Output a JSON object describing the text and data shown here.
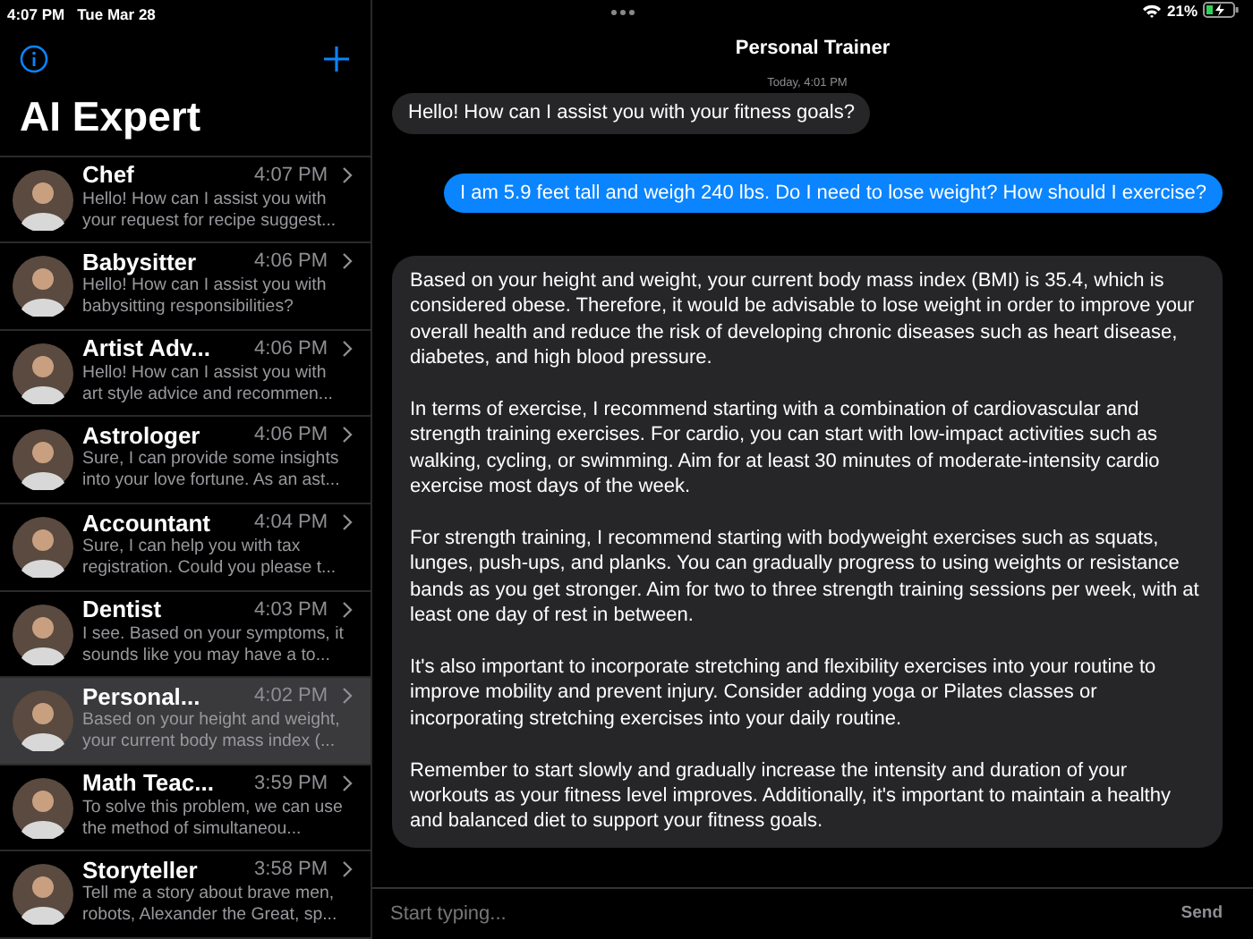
{
  "status_bar": {
    "time": "4:07 PM",
    "date": "Tue Mar 28",
    "battery": "21%"
  },
  "sidebar": {
    "title": "AI Expert",
    "items": [
      {
        "name": "Chef",
        "time": "4:07 PM",
        "preview": "Hello! How can I assist you with your request for recipe suggest...",
        "selected": false
      },
      {
        "name": "Babysitter",
        "time": "4:06 PM",
        "preview": "Hello! How can I assist you with babysitting responsibilities?",
        "selected": false
      },
      {
        "name": "Artist Adv...",
        "time": "4:06 PM",
        "preview": "Hello! How can I assist you with art style advice and recommen...",
        "selected": false
      },
      {
        "name": "Astrologer",
        "time": "4:06 PM",
        "preview": "Sure, I can provide some insights into your love fortune. As an ast...",
        "selected": false
      },
      {
        "name": "Accountant",
        "time": "4:04 PM",
        "preview": "Sure, I can help you with tax registration. Could you please t...",
        "selected": false
      },
      {
        "name": "Dentist",
        "time": "4:03 PM",
        "preview": "I see. Based on your symptoms, it sounds like you may have a to...",
        "selected": false
      },
      {
        "name": "Personal...",
        "time": "4:02 PM",
        "preview": "Based on your height and weight, your current body mass index (...",
        "selected": true
      },
      {
        "name": "Math Teac...",
        "time": "3:59 PM",
        "preview": "To solve this problem, we can use the method of simultaneou...",
        "selected": false
      },
      {
        "name": "Storyteller",
        "time": "3:58 PM",
        "preview": "Tell me a story about brave men, robots, Alexander the Great, sp...",
        "selected": false
      }
    ]
  },
  "chat": {
    "title": "Personal Trainer",
    "timestamp": "Today, 4:01 PM",
    "messages": [
      {
        "kind": "received",
        "paragraphs": [
          "Hello! How can I assist you with your fitness goals?"
        ]
      },
      {
        "kind": "sent",
        "paragraphs": [
          "I am 5.9 feet tall and weigh 240 lbs. Do I need to lose weight? How should I exercise?"
        ]
      },
      {
        "kind": "received",
        "paragraphs": [
          "Based on your height and weight, your current body mass index (BMI) is 35.4, which is considered obese. Therefore, it would be advisable to lose weight in order to improve your overall health and reduce the risk of developing chronic diseases such as heart disease, diabetes, and high blood pressure.",
          "In terms of exercise, I recommend starting with a combination of cardiovascular and strength training exercises. For cardio, you can start with low-impact activities such as walking, cycling, or swimming. Aim for at least 30 minutes of moderate-intensity cardio exercise most days of the week.",
          "For strength training, I recommend starting with bodyweight exercises such as squats, lunges, push-ups, and planks. You can gradually progress to using weights or resistance bands as you get stronger. Aim for two to three strength training sessions per week, with at least one day of rest in between.",
          "It's also important to incorporate stretching and flexibility exercises into your routine to improve mobility and prevent injury. Consider adding yoga or Pilates classes or incorporating stretching exercises into your daily routine.",
          "Remember to start slowly and gradually increase the intensity and duration of your workouts as your fitness level improves. Additionally, it's important to maintain a healthy and balanced diet to support your fitness goals."
        ]
      }
    ],
    "input": {
      "placeholder": "Start typing...",
      "send": "Send"
    }
  }
}
